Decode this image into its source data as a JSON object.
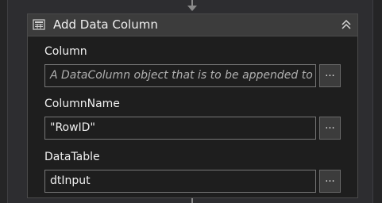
{
  "activity": {
    "title": "Add Data Column",
    "icon": "table-column-icon",
    "collapse_icon": "double-chevron-up-icon"
  },
  "fields": [
    {
      "label": "Column",
      "value": "",
      "placeholder": "A DataColumn object that is to be appended to the",
      "button": "..."
    },
    {
      "label": "ColumnName",
      "value": "\"RowID\"",
      "placeholder": "",
      "button": "..."
    },
    {
      "label": "DataTable",
      "value": "dtInput",
      "placeholder": "",
      "button": "..."
    }
  ]
}
